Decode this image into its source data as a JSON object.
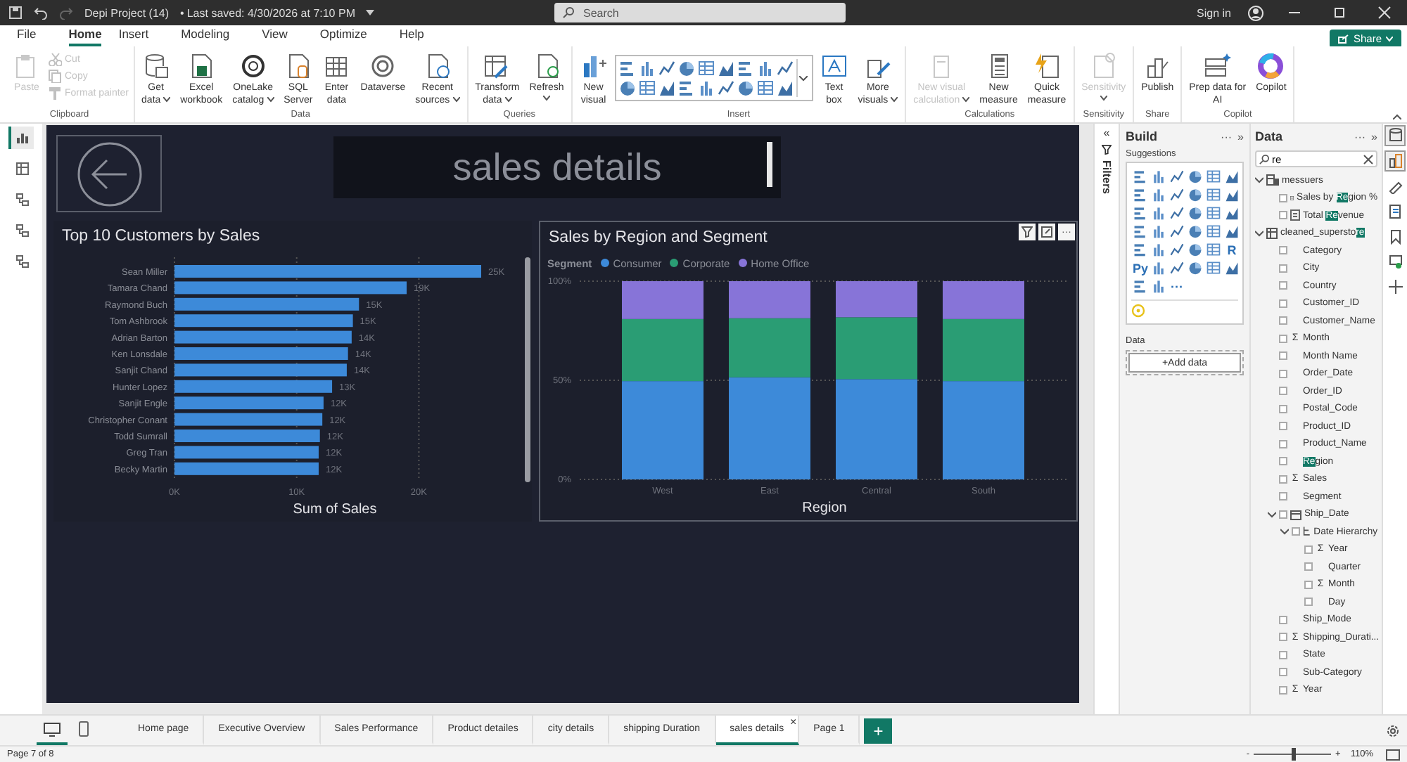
{
  "title_bar": {
    "file_title": "Depi Project (14)",
    "separator": "•",
    "saved": "Last saved: 4/30/2026 at 7:10 PM",
    "search": {
      "placeholder": "Search"
    },
    "sign_in": "Sign in"
  },
  "menu": [
    {
      "label": "File",
      "selected": false
    },
    {
      "label": "Home",
      "selected": true
    },
    {
      "label": "Insert",
      "selected": false
    },
    {
      "label": "Modeling",
      "selected": false
    },
    {
      "label": "View",
      "selected": false
    },
    {
      "label": "Optimize",
      "selected": false
    },
    {
      "label": "Help",
      "selected": false
    }
  ],
  "share_button": "Share",
  "ribbon": [
    {
      "group": "Clipboard",
      "items": [
        {
          "kind": "paste",
          "lines": [
            "Paste"
          ],
          "dropdown": false,
          "disabled": true
        }
      ],
      "small_items": [
        {
          "kind": "cut",
          "label": "Cut",
          "disabled": true
        },
        {
          "kind": "copy",
          "label": "Copy",
          "disabled": true
        },
        {
          "kind": "format_painter",
          "label": "Format painter",
          "disabled": true
        }
      ]
    },
    {
      "group": "Data",
      "items": [
        {
          "kind": "get_data",
          "lines": [
            "Get",
            "data"
          ],
          "dropdown": true,
          "disabled": false
        },
        {
          "kind": "excel",
          "lines": [
            "Excel",
            "workbook"
          ],
          "dropdown": false,
          "disabled": false
        },
        {
          "kind": "onelake",
          "lines": [
            "OneLake",
            "catalog"
          ],
          "dropdown": true,
          "disabled": false
        },
        {
          "kind": "sql",
          "lines": [
            "SQL",
            "Server"
          ],
          "dropdown": false,
          "disabled": false
        },
        {
          "kind": "enter_data",
          "lines": [
            "Enter",
            "data"
          ],
          "dropdown": false,
          "disabled": false
        },
        {
          "kind": "dataverse",
          "lines": [
            "Dataverse"
          ],
          "dropdown": false,
          "disabled": false
        },
        {
          "kind": "recent",
          "lines": [
            "Recent",
            "sources"
          ],
          "dropdown": true,
          "disabled": false
        }
      ]
    },
    {
      "group": "Queries",
      "items": [
        {
          "kind": "transform",
          "lines": [
            "Transform",
            "data"
          ],
          "dropdown": true,
          "disabled": false
        },
        {
          "kind": "refresh",
          "lines": [
            "Refresh"
          ],
          "dropdown": true,
          "disabled": false
        }
      ]
    },
    {
      "group": "Insert",
      "items": [
        {
          "kind": "new_visual",
          "lines": [
            "New",
            "visual"
          ],
          "dropdown": false,
          "disabled": false
        },
        {
          "kind": "gallery"
        },
        {
          "kind": "text_box",
          "lines": [
            "Text",
            "box"
          ],
          "dropdown": false,
          "disabled": false
        },
        {
          "kind": "more_visuals",
          "lines": [
            "More",
            "visuals"
          ],
          "dropdown": true,
          "disabled": false
        }
      ]
    },
    {
      "group": "Calculations",
      "items": [
        {
          "kind": "new_calc",
          "lines": [
            "New visual",
            "calculation"
          ],
          "dropdown": true,
          "disabled": true
        },
        {
          "kind": "new_measure",
          "lines": [
            "New",
            "measure"
          ],
          "dropdown": false,
          "disabled": false
        },
        {
          "kind": "quick_measure",
          "lines": [
            "Quick",
            "measure"
          ],
          "dropdown": false,
          "disabled": false
        }
      ]
    },
    {
      "group": "Sensitivity",
      "items": [
        {
          "kind": "sensitivity",
          "lines": [
            "Sensitivity"
          ],
          "dropdown": true,
          "disabled": true
        }
      ]
    },
    {
      "group": "Share",
      "items": [
        {
          "kind": "publish",
          "lines": [
            "Publish"
          ],
          "dropdown": false,
          "disabled": false
        }
      ]
    },
    {
      "group": "Copilot",
      "items": [
        {
          "kind": "prep_ai",
          "lines": [
            "Prep data for",
            "AI"
          ],
          "dropdown": false,
          "disabled": false
        },
        {
          "kind": "copilot",
          "lines": [
            "Copilot"
          ],
          "dropdown": false,
          "disabled": false
        }
      ]
    }
  ],
  "left_views": [
    {
      "selected": true
    },
    {
      "selected": false
    },
    {
      "selected": false
    },
    {
      "selected": false
    },
    {
      "selected": false
    }
  ],
  "report": {
    "title": "sales details",
    "visuals": [
      {
        "chart_data": {
          "type": "bar",
          "orientation": "horizontal",
          "title": "Top 10 Customers by Sales",
          "xlabel": "Sum of Sales",
          "categories": [
            "Sean Miller",
            "Tamara Chand",
            "Raymond Buch",
            "Tom Ashbrook",
            "Adrian Barton",
            "Ken Lonsdale",
            "Sanjit Chand",
            "Hunter Lopez",
            "Sanjit Engle",
            "Christopher Conant",
            "Todd Sumrall",
            "Greg Tran",
            "Becky Martin"
          ],
          "series": [
            {
              "color": "#3d8ad9",
              "values": [
                25.1,
                19.0,
                15.1,
                14.6,
                14.5,
                14.2,
                14.1,
                12.9,
                12.2,
                12.1,
                11.9,
                11.8,
                11.8
              ]
            }
          ],
          "xlim": [
            0,
            25.1
          ],
          "xticks": [
            {
              "value": 0,
              "label": "0K"
            },
            {
              "value": 10,
              "label": "10K"
            },
            {
              "value": 20,
              "label": "20K"
            }
          ],
          "value_labels": [
            "25K",
            "19K",
            "15K",
            "15K",
            "14K",
            "14K",
            "14K",
            "13K",
            "12K",
            "12K",
            "12K",
            "12K",
            "12K"
          ]
        }
      },
      {
        "more": "···",
        "chart_data": {
          "type": "bar",
          "stacked": true,
          "title": "Sales by Region and Segment",
          "xlabel": "Region",
          "legend": {
            "title": "Segment"
          },
          "categories": [
            "West",
            "East",
            "Central",
            "South"
          ],
          "series": [
            {
              "name": "Consumer",
              "color": "#3d8ad9",
              "values": [
                49.6,
                51.5,
                50.6,
                49.6
              ]
            },
            {
              "name": "Corporate",
              "color": "#2a9d74",
              "values": [
                31.3,
                29.8,
                31.2,
                31.3
              ]
            },
            {
              "name": "Home Office",
              "color": "#8774d8",
              "values": [
                19.1,
                18.7,
                18.2,
                19.1
              ]
            }
          ],
          "ylim": [
            0,
            100
          ],
          "yticks": [
            {
              "value": 0,
              "label": "0%"
            },
            {
              "value": 50,
              "label": "50%"
            },
            {
              "value": 100,
              "label": "100%"
            }
          ]
        }
      }
    ]
  },
  "filters_pane": {
    "collapse": "«",
    "title": "Filters"
  },
  "build_pane": {
    "title": "Build",
    "more": "···",
    "collapse": "»",
    "suggestions_title": "Suggestions",
    "suggestions": [
      {
        "kind": "visual"
      },
      {
        "kind": "visual"
      },
      {
        "kind": "visual"
      },
      {
        "kind": "visual"
      },
      {
        "kind": "visual"
      },
      {
        "kind": "visual"
      },
      {
        "kind": "visual"
      },
      {
        "kind": "visual"
      },
      {
        "kind": "visual"
      },
      {
        "kind": "visual"
      },
      {
        "kind": "visual"
      },
      {
        "kind": "visual"
      },
      {
        "kind": "visual"
      },
      {
        "kind": "visual"
      },
      {
        "kind": "visual"
      },
      {
        "kind": "visual"
      },
      {
        "kind": "visual"
      },
      {
        "kind": "visual"
      },
      {
        "kind": "visual"
      },
      {
        "kind": "visual"
      },
      {
        "kind": "visual"
      },
      {
        "kind": "visual"
      },
      {
        "kind": "visual"
      },
      {
        "kind": "visual"
      },
      {
        "kind": "visual"
      },
      {
        "kind": "visual"
      },
      {
        "kind": "visual"
      },
      {
        "kind": "visual"
      },
      {
        "kind": "visual"
      },
      {
        "kind": "text",
        "label": "R"
      },
      {
        "kind": "text",
        "label": "Py"
      },
      {
        "kind": "visual"
      },
      {
        "kind": "visual"
      },
      {
        "kind": "visual"
      },
      {
        "kind": "visual"
      },
      {
        "kind": "visual"
      },
      {
        "kind": "visual"
      },
      {
        "kind": "visual"
      },
      {
        "kind": "text",
        "label": "···"
      }
    ],
    "data_title": "Data",
    "add_data": "+Add data"
  },
  "data_pane": {
    "title": "Data",
    "more": "···",
    "collapse": "»",
    "search": {
      "value": "re"
    },
    "tree": [
      {
        "kind": "measures_table",
        "label": "messuers",
        "expanded": true,
        "children": [
          {
            "kind": "measure",
            "checked": false,
            "label": "Sales by ",
            "match": "Re",
            "rest": "gion %"
          },
          {
            "kind": "measure",
            "checked": false,
            "label": "Total ",
            "match": "Re",
            "rest": "venue"
          }
        ]
      },
      {
        "kind": "table",
        "label": "cleaned_supersto",
        "match": "re",
        "expanded": true,
        "children": [
          {
            "kind": "field",
            "checked": false,
            "label": "Category"
          },
          {
            "kind": "field",
            "checked": false,
            "label": "City"
          },
          {
            "kind": "field",
            "checked": false,
            "label": "Country"
          },
          {
            "kind": "field",
            "checked": false,
            "label": "Customer_ID"
          },
          {
            "kind": "field",
            "checked": false,
            "label": "Customer_Name"
          },
          {
            "kind": "field",
            "checked": false,
            "symbol": "Σ",
            "label": "Month"
          },
          {
            "kind": "field",
            "checked": false,
            "label": "Month Name"
          },
          {
            "kind": "field",
            "checked": false,
            "label": "Order_Date"
          },
          {
            "kind": "field",
            "checked": false,
            "label": "Order_ID"
          },
          {
            "kind": "field",
            "checked": false,
            "label": "Postal_Code"
          },
          {
            "kind": "field",
            "checked": false,
            "label": "Product_ID"
          },
          {
            "kind": "field",
            "checked": false,
            "label": "Product_Name"
          },
          {
            "kind": "field",
            "checked": false,
            "match": "Re",
            "rest": "gion"
          },
          {
            "kind": "field",
            "checked": false,
            "symbol": "Σ",
            "label": "Sales"
          },
          {
            "kind": "field",
            "checked": false,
            "label": "Segment"
          },
          {
            "kind": "date",
            "checked": false,
            "label": "Ship_Date",
            "expanded": true,
            "children": [
              {
                "kind": "hierarchy",
                "checked": false,
                "label": "Date Hierarchy",
                "expanded": true,
                "children": [
                  {
                    "kind": "field",
                    "checked": false,
                    "symbol": "Σ",
                    "label": "Year"
                  },
                  {
                    "kind": "field",
                    "checked": false,
                    "label": "Quarter"
                  },
                  {
                    "kind": "field",
                    "checked": false,
                    "symbol": "Σ",
                    "label": "Month"
                  },
                  {
                    "kind": "field",
                    "checked": false,
                    "label": "Day"
                  }
                ]
              }
            ]
          },
          {
            "kind": "field",
            "checked": false,
            "label": "Ship_Mode"
          },
          {
            "kind": "field",
            "checked": false,
            "symbol": "Σ",
            "label": "Shipping_Durati..."
          },
          {
            "kind": "field",
            "checked": false,
            "label": "State"
          },
          {
            "kind": "field",
            "checked": false,
            "label": "Sub-Category"
          },
          {
            "kind": "field",
            "checked": false,
            "symbol": "Σ",
            "label": "Year"
          }
        ]
      }
    ]
  },
  "pane_toggles": [
    {
      "kind": "data",
      "selected": true
    },
    {
      "kind": "build",
      "selected": true
    },
    {
      "kind": "format",
      "selected": false
    },
    {
      "kind": "bookmark_list",
      "selected": false
    },
    {
      "kind": "bookmark",
      "selected": false
    },
    {
      "kind": "sync",
      "selected": false
    },
    {
      "kind": "add",
      "selected": false
    }
  ],
  "page_tabs": {
    "views": [
      {
        "kind": "desktop",
        "selected": true
      },
      {
        "kind": "mobile",
        "selected": false
      }
    ],
    "tabs": [
      {
        "label": "Home page",
        "selected": false
      },
      {
        "label": "Executive Overview",
        "selected": false
      },
      {
        "label": "Sales Performance",
        "selected": false
      },
      {
        "label": "Product detailes",
        "selected": false
      },
      {
        "label": "city details",
        "selected": false
      },
      {
        "label": "shipping Duration",
        "selected": false
      },
      {
        "label": "sales details",
        "selected": true
      },
      {
        "label": "Page 1",
        "selected": false
      }
    ],
    "close": "×",
    "add": "+"
  },
  "status_bar": {
    "page": "Page 7 of 8",
    "zoom": {
      "minus": "-",
      "plus": "+",
      "level": 0.5,
      "reading": "110%"
    }
  }
}
